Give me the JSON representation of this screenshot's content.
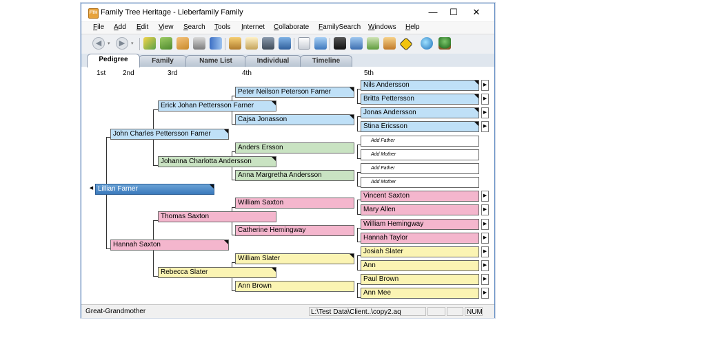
{
  "window": {
    "app_icon_text": "FTH",
    "title": "Family Tree Heritage - Lieberfamily Family",
    "controls": {
      "minimize": "—",
      "maximize": "☐",
      "close": "✕"
    }
  },
  "menu": [
    "File",
    "Add",
    "Edit",
    "View",
    "Search",
    "Tools",
    "Internet",
    "Collaborate",
    "FamilySearch",
    "Windows",
    "Help"
  ],
  "toolbar": {
    "nav": {
      "back": "◀",
      "forward": "▶",
      "dropdown": "▾"
    },
    "icons": [
      "open-book-icon",
      "import-icon",
      "export-icon",
      "print-icon",
      "book-icon",
      "user-edit-icon",
      "notes-icon",
      "camera-icon",
      "user-add-icon",
      "report-icon",
      "list-icon",
      "binoculars-icon",
      "chart-icon",
      "grid-icon",
      "home-icon",
      "warning-icon",
      "web-icon",
      "tree-icon"
    ]
  },
  "tabs": [
    "Pedigree",
    "Family",
    "Name List",
    "Individual",
    "Timeline"
  ],
  "active_tab": "Pedigree",
  "generations": [
    "1st",
    "2nd",
    "3rd",
    "4th",
    "5th"
  ],
  "pedigree": {
    "root": "Lillian Farner",
    "gen2": [
      "John Charles Pettersson Farner",
      "Hannah Saxton"
    ],
    "gen3": [
      "Erick Johan Pettersson Farner",
      "Johanna Charlotta Andersson",
      "Thomas Saxton",
      "Rebecca Slater"
    ],
    "gen4": [
      "Peter Neilson Peterson Farner",
      "Cajsa Jonasson",
      "Anders Ersson",
      "Anna Margretha Andersson",
      "William Saxton",
      "Catherine Hemingway",
      "William Slater",
      "Ann Brown"
    ],
    "gen5": [
      "Nils Andersson",
      "Britta Pettersson",
      "Jonas Andersson",
      "Stina Ericsson",
      "Add Father",
      "Add Mother",
      "Add Father",
      "Add Mother",
      "Vincent Saxton",
      "Mary Allen",
      "William Hemingway",
      "Hannah Taylor",
      "Josiah Slater",
      "Ann",
      "Paul Brown",
      "Ann Mee"
    ]
  },
  "expand_arrow": "▶",
  "collapse_arrow": "◀",
  "status": {
    "relationship": "Great-Grandmother",
    "file": "L:\\Test Data\\Client..\\copy2.aq",
    "num": "NUM"
  },
  "colors": {
    "paternal_line": "#bfe0f7",
    "paternal_maternal_line": "#c9e3c2",
    "maternal_line": "#f4b6cd",
    "maternal_maternal_line": "#fbf4b3",
    "root": "#3a79bb"
  }
}
